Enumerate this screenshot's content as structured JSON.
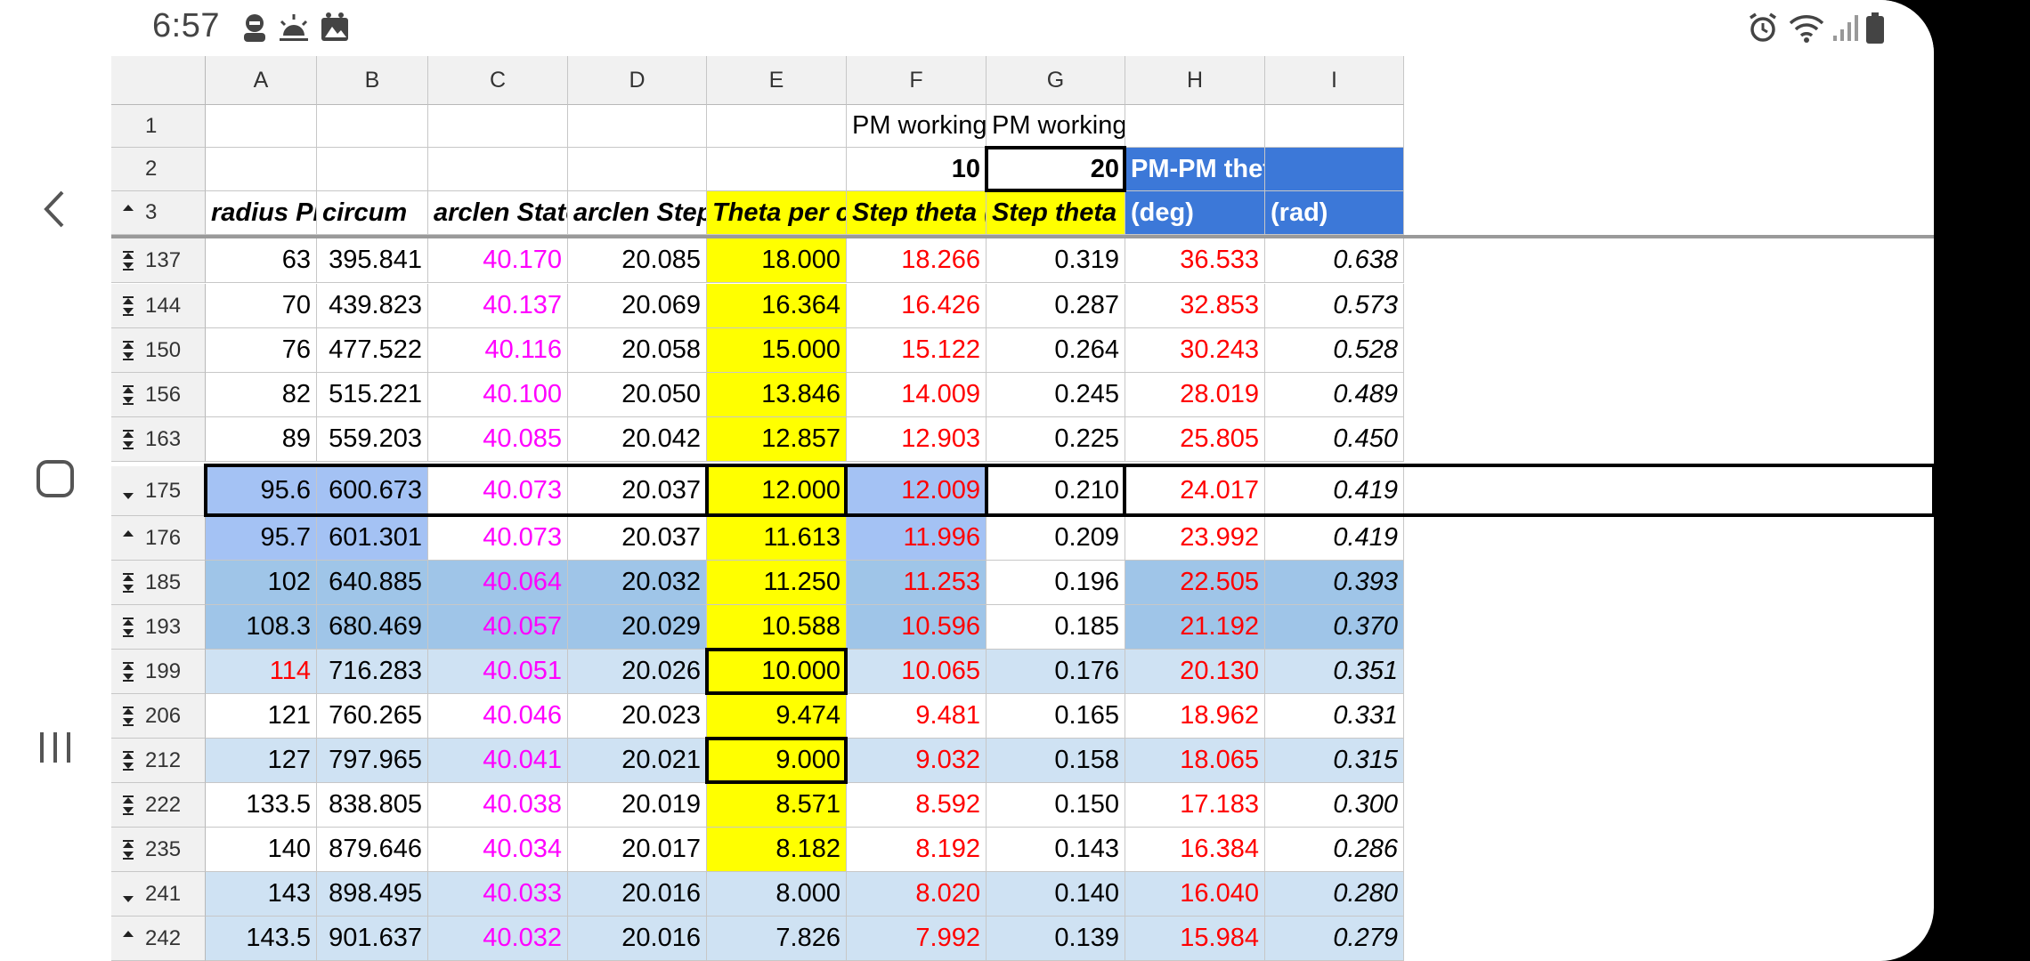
{
  "status_bar": {
    "time": "6:57",
    "left_icons": [
      "account-icon",
      "weather-icon",
      "photos-icon"
    ],
    "right_icons": [
      "alarm-icon",
      "wifi-icon",
      "signal-icon",
      "battery-icon"
    ]
  },
  "nav": {
    "buttons": [
      "back-icon",
      "home-icon",
      "recents-icon"
    ]
  },
  "colors": {
    "yellow": "#ffff00",
    "blue_header": "#3c78d8",
    "blue_mid": "#a4c2f4",
    "blue_dark": "#9fc5e8",
    "blue_light": "#cfe2f3",
    "magenta": "#ff00ff",
    "red": "#ff0000"
  },
  "columns": [
    "A",
    "B",
    "C",
    "D",
    "E",
    "F",
    "G",
    "H",
    "I"
  ],
  "header_rows": [
    {
      "num": "1",
      "mark": "",
      "cells": [
        "",
        "",
        "",
        "",
        "",
        "PM working radius",
        "PM working diameter",
        "",
        ""
      ]
    },
    {
      "num": "2",
      "mark": "",
      "cells": [
        "",
        "",
        "",
        "",
        "",
        "10",
        "20",
        "PM-PM theta",
        ""
      ]
    },
    {
      "num": "3",
      "mark": "up",
      "cells": [
        "radius PM-axis",
        "circum",
        "arclen Stators",
        "arclen Steps",
        "Theta per count",
        "Step theta (deg)",
        "Step theta (rad)",
        "(deg)",
        "(rad)"
      ]
    }
  ],
  "rows": [
    {
      "num": "137",
      "mark": "both",
      "cells": [
        "63",
        "395.841",
        "40.170",
        "20.085",
        "18.000",
        "18.266",
        "0.319",
        "36.533",
        "0.638"
      ]
    },
    {
      "num": "144",
      "mark": "both",
      "cells": [
        "70",
        "439.823",
        "40.137",
        "20.069",
        "16.364",
        "16.426",
        "0.287",
        "32.853",
        "0.573"
      ]
    },
    {
      "num": "150",
      "mark": "both",
      "cells": [
        "76",
        "477.522",
        "40.116",
        "20.058",
        "15.000",
        "15.122",
        "0.264",
        "30.243",
        "0.528"
      ]
    },
    {
      "num": "156",
      "mark": "both",
      "cells": [
        "82",
        "515.221",
        "40.100",
        "20.050",
        "13.846",
        "14.009",
        "0.245",
        "28.019",
        "0.489"
      ]
    },
    {
      "num": "163",
      "mark": "both",
      "cells": [
        "89",
        "559.203",
        "40.085",
        "20.042",
        "12.857",
        "12.903",
        "0.225",
        "25.805",
        "0.450"
      ]
    },
    {
      "num": "175",
      "mark": "down",
      "cells": [
        "95.6",
        "600.673",
        "40.073",
        "20.037",
        "12.000",
        "12.009",
        "0.210",
        "24.017",
        "0.419"
      ]
    },
    {
      "num": "176",
      "mark": "up",
      "cells": [
        "95.7",
        "601.301",
        "40.073",
        "20.037",
        "11.613",
        "11.996",
        "0.209",
        "23.992",
        "0.419"
      ]
    },
    {
      "num": "185",
      "mark": "both",
      "cells": [
        "102",
        "640.885",
        "40.064",
        "20.032",
        "11.250",
        "11.253",
        "0.196",
        "22.505",
        "0.393"
      ]
    },
    {
      "num": "193",
      "mark": "both",
      "cells": [
        "108.3",
        "680.469",
        "40.057",
        "20.029",
        "10.588",
        "10.596",
        "0.185",
        "21.192",
        "0.370"
      ]
    },
    {
      "num": "199",
      "mark": "both",
      "cells": [
        "114",
        "716.283",
        "40.051",
        "20.026",
        "10.000",
        "10.065",
        "0.176",
        "20.130",
        "0.351"
      ]
    },
    {
      "num": "206",
      "mark": "both",
      "cells": [
        "121",
        "760.265",
        "40.046",
        "20.023",
        "9.474",
        "9.481",
        "0.165",
        "18.962",
        "0.331"
      ]
    },
    {
      "num": "212",
      "mark": "both",
      "cells": [
        "127",
        "797.965",
        "40.041",
        "20.021",
        "9.000",
        "9.032",
        "0.158",
        "18.065",
        "0.315"
      ]
    },
    {
      "num": "222",
      "mark": "both",
      "cells": [
        "133.5",
        "838.805",
        "40.038",
        "20.019",
        "8.571",
        "8.592",
        "0.150",
        "17.183",
        "0.300"
      ]
    },
    {
      "num": "235",
      "mark": "both",
      "cells": [
        "140",
        "879.646",
        "40.034",
        "20.017",
        "8.182",
        "8.192",
        "0.143",
        "16.384",
        "0.286"
      ]
    },
    {
      "num": "241",
      "mark": "down",
      "cells": [
        "143",
        "898.495",
        "40.033",
        "20.016",
        "8.000",
        "8.020",
        "0.140",
        "16.040",
        "0.280"
      ]
    },
    {
      "num": "242",
      "mark": "up",
      "cells": [
        "143.5",
        "901.637",
        "40.032",
        "20.016",
        "7.826",
        "7.992",
        "0.139",
        "15.984",
        "0.279"
      ]
    }
  ]
}
